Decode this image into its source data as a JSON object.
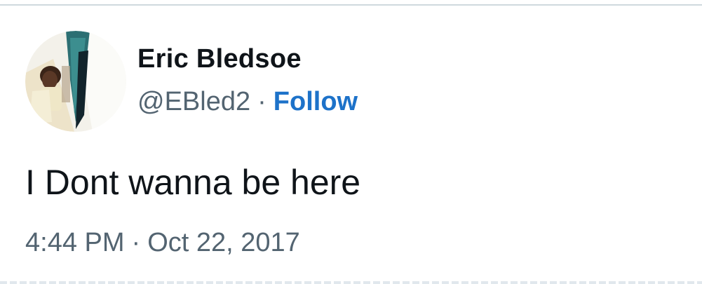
{
  "author": {
    "name": "Eric Bledsoe",
    "handle": "@EBled2",
    "separator": "·",
    "follow_label": "Follow",
    "avatar_icon": "profile-photo"
  },
  "tweet": {
    "text": "I Dont wanna be here",
    "time": "4:44 PM",
    "separator": "·",
    "date": "Oct 22, 2017"
  },
  "colors": {
    "name": "#0f1419",
    "secondary": "#536471",
    "follow": "#1d72c9",
    "border": "#cfd9de"
  }
}
